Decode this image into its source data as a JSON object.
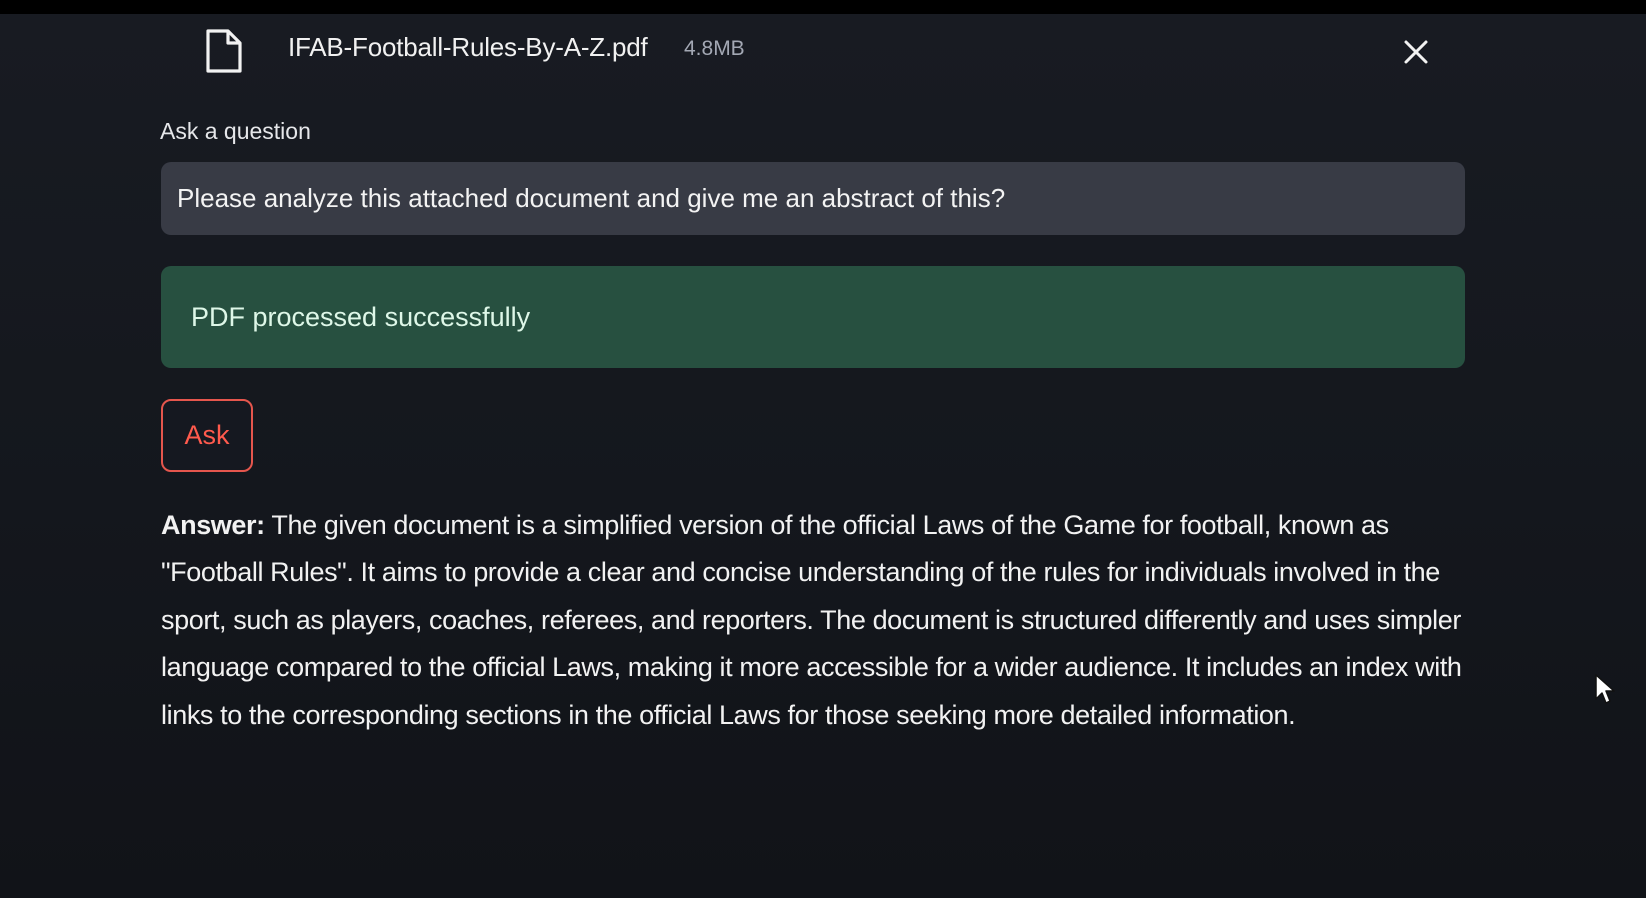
{
  "file": {
    "name": "IFAB-Football-Rules-By-A-Z.pdf",
    "size": "4.8MB",
    "icon": "document-icon",
    "close_icon": "close-icon"
  },
  "question": {
    "label": "Ask a question",
    "value": "Please analyze this attached document and give me an abstract of this?"
  },
  "status": {
    "message": "PDF processed successfully"
  },
  "ask_button": {
    "label": "Ask"
  },
  "answer": {
    "label": "Answer:",
    "text": "The given document is a simplified version of the official Laws of the Game for football, known as \"Football Rules\". It aims to provide a clear and concise understanding of the rules for individuals involved in the sport, such as players, coaches, referees, and reporters. The document is structured differently and uses simpler language compared to the official Laws, making it more accessible for a wider audience. It includes an index with links to the corresponding sections in the official Laws for those seeking more detailed information."
  },
  "colors": {
    "background": "#0e1117",
    "input_background": "#383b45",
    "success_background": "#275040",
    "success_text": "#def7e8",
    "button_accent": "#ff5a4d"
  }
}
